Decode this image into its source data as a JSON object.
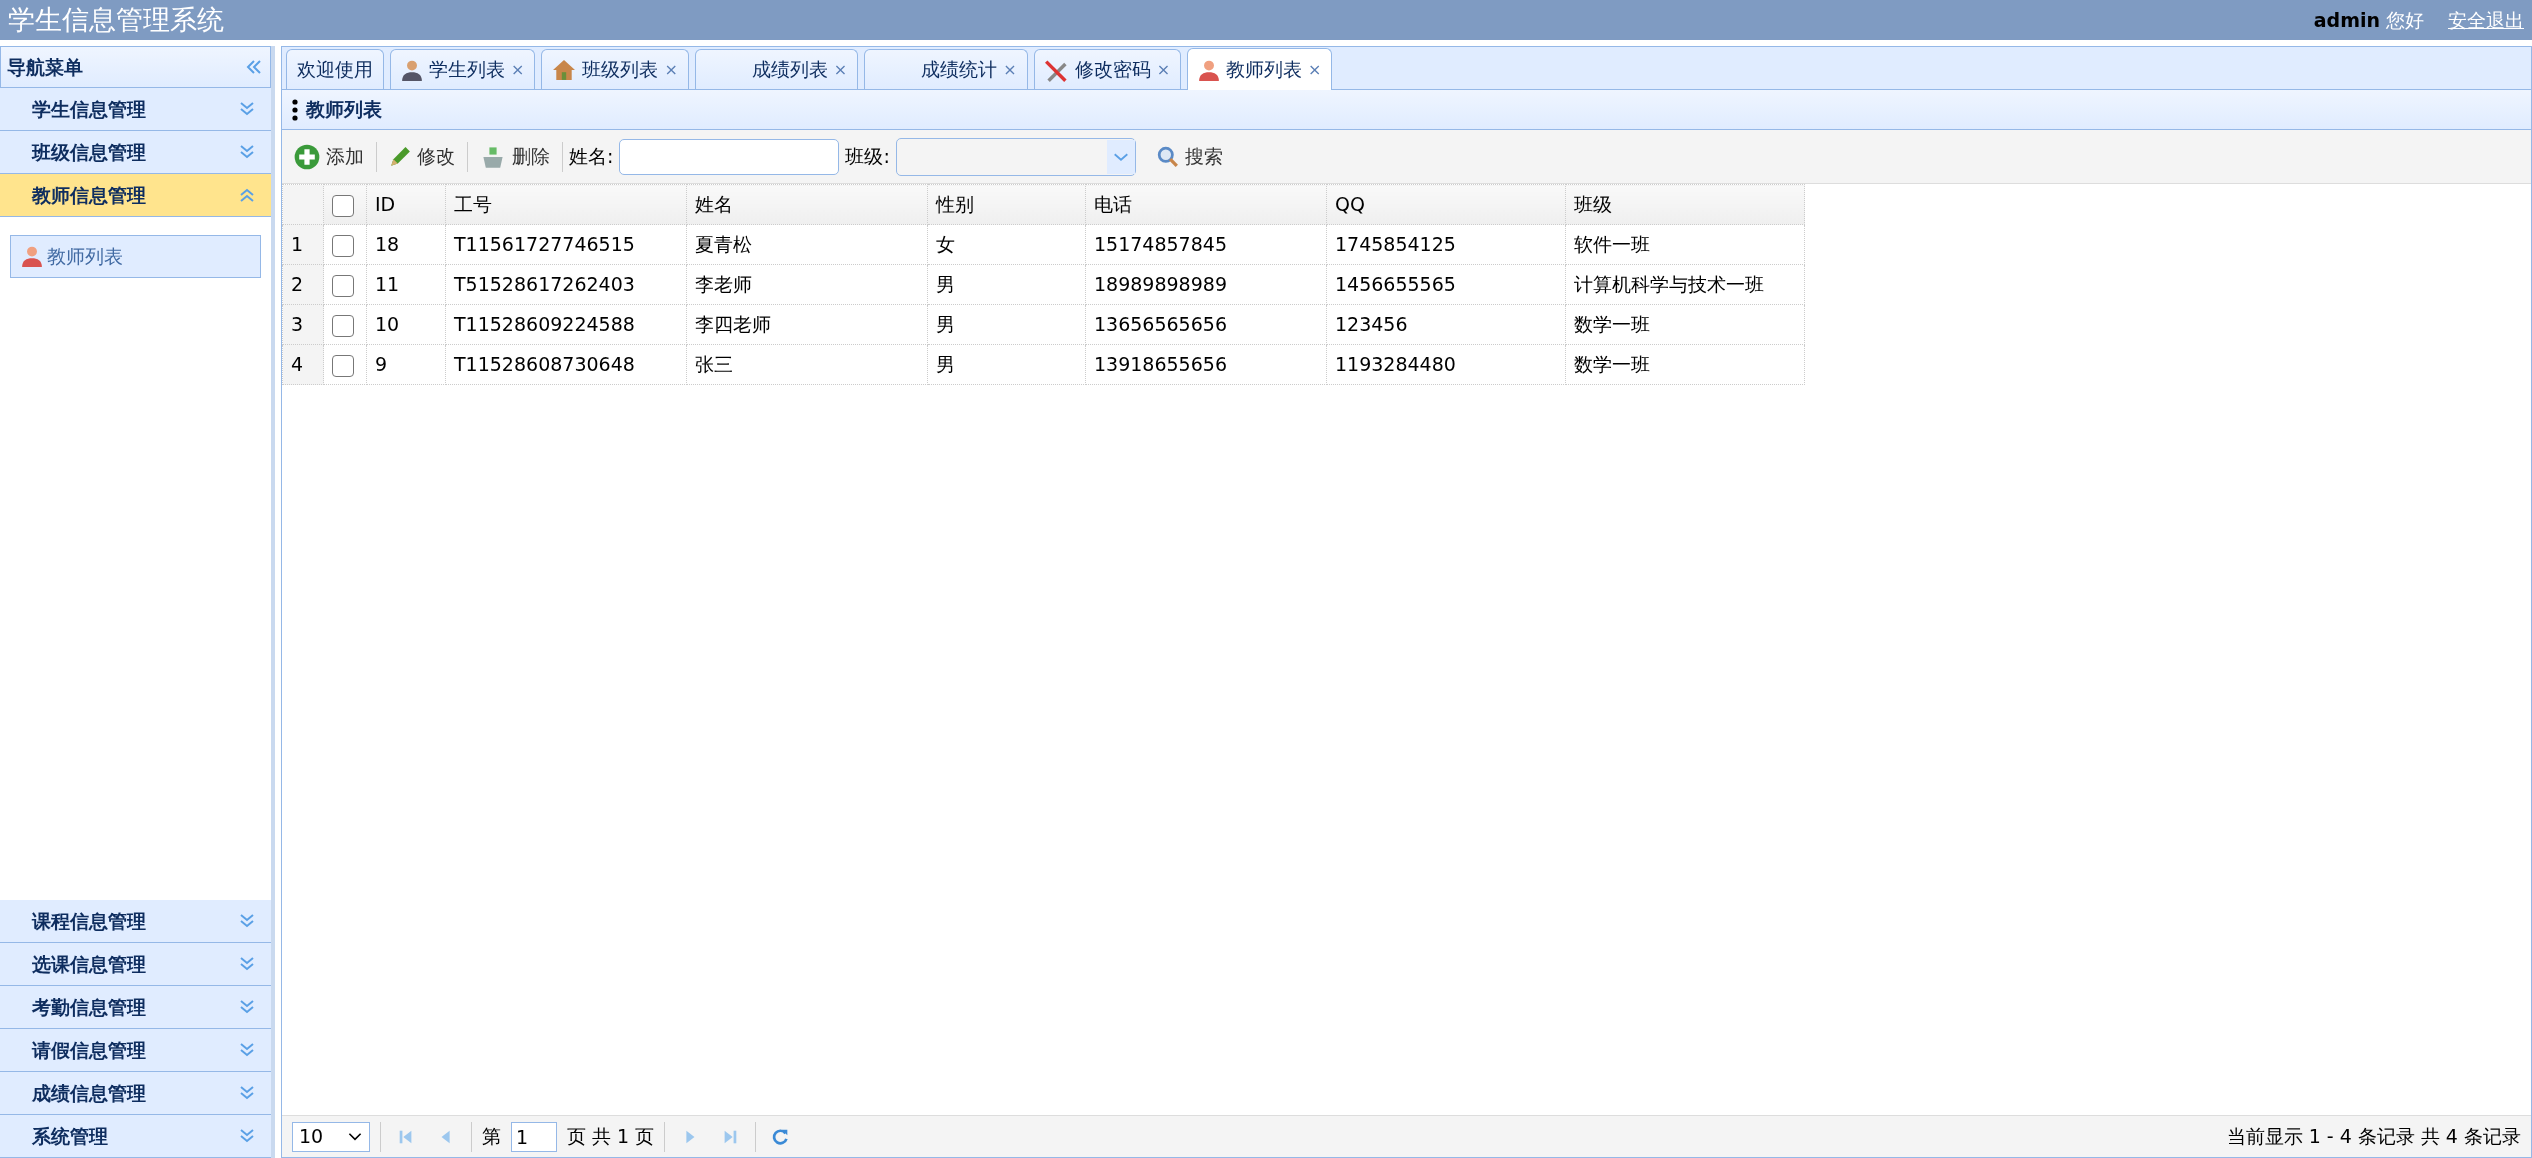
{
  "header": {
    "title": "学生信息管理系统",
    "user": "admin",
    "greeting": "您好",
    "logout": "安全退出"
  },
  "sidebar": {
    "title": "导航菜单",
    "groups": [
      {
        "label": "学生信息管理",
        "expanded": false
      },
      {
        "label": "班级信息管理",
        "expanded": false
      },
      {
        "label": "教师信息管理",
        "expanded": true,
        "children": [
          {
            "label": "教师列表",
            "selected": true
          }
        ]
      },
      {
        "label": "课程信息管理",
        "expanded": false
      },
      {
        "label": "选课信息管理",
        "expanded": false
      },
      {
        "label": "考勤信息管理",
        "expanded": false
      },
      {
        "label": "请假信息管理",
        "expanded": false
      },
      {
        "label": "成绩信息管理",
        "expanded": false
      },
      {
        "label": "系统管理",
        "expanded": false
      }
    ]
  },
  "tabs": [
    {
      "label": "欢迎使用",
      "selected": false
    },
    {
      "label": "学生列表",
      "close": "×",
      "selected": false
    },
    {
      "label": "班级列表",
      "close": "×",
      "selected": false
    },
    {
      "label": "成绩列表",
      "close": "×",
      "selected": false
    },
    {
      "label": "成绩统计",
      "close": "×",
      "selected": false
    },
    {
      "label": "修改密码",
      "close": "×",
      "selected": false
    },
    {
      "label": "教师列表",
      "close": "×",
      "selected": true
    }
  ],
  "panel": {
    "title": "教师列表"
  },
  "toolbar": {
    "buttons": [
      {
        "label": "添加"
      },
      {
        "label": "修改"
      },
      {
        "label": "删除"
      }
    ],
    "name_label": "姓名:",
    "class_label": "班级:",
    "search": "搜索"
  },
  "table": {
    "columns": [
      "ID",
      "工号",
      "姓名",
      "性别",
      "电话",
      "QQ",
      "班级"
    ],
    "header_checked": false,
    "rows": [
      {
        "number": "1",
        "checked": false,
        "cells": [
          "18",
          "T11561727746515",
          "夏青松",
          "女",
          "15174857845",
          "1745854125",
          "软件一班"
        ]
      },
      {
        "number": "2",
        "checked": false,
        "cells": [
          "11",
          "T51528617262403",
          "李老师",
          "男",
          "18989898989",
          "1456655565",
          "计算机科学与技术一班"
        ]
      },
      {
        "number": "3",
        "checked": false,
        "cells": [
          "10",
          "T11528609224588",
          "李四老师",
          "男",
          "13656565656",
          "123456",
          "数学一班"
        ]
      },
      {
        "number": "4",
        "checked": false,
        "cells": [
          "9",
          "T11528608730648",
          "张三",
          "男",
          "13918655656",
          "1193284480",
          "数学一班"
        ]
      }
    ]
  },
  "pager": {
    "page_size": "10",
    "page_prefix": "第",
    "page": "1",
    "page_suffix": "页 共 1 页",
    "summary": "当前显示 1 - 4 条记录 共 4 条记录"
  }
}
